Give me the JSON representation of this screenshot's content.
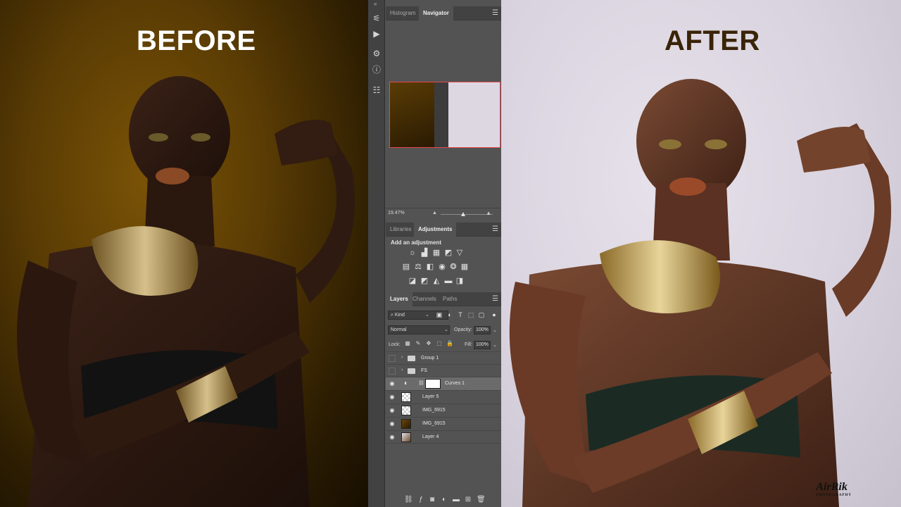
{
  "before": {
    "caption": "BEFORE"
  },
  "after": {
    "caption": "AFTER",
    "watermark": "AirRik",
    "watermark_sub": "PHOTOGRAPHY"
  },
  "navigator": {
    "tabs": [
      {
        "label": "Histogram",
        "active": false
      },
      {
        "label": "Navigator",
        "active": true
      }
    ],
    "zoom": "19.47%"
  },
  "adjustments": {
    "tabs": [
      {
        "label": "Libraries",
        "active": false
      },
      {
        "label": "Adjustments",
        "active": true
      }
    ],
    "title": "Add an adjustment"
  },
  "layers_panel": {
    "tabs": [
      {
        "label": "Layers",
        "active": true
      },
      {
        "label": "Channels",
        "active": false
      },
      {
        "label": "Paths",
        "active": false
      }
    ],
    "kind_filter": "Kind",
    "blend_mode": "Normal",
    "opacity_label": "Opacity:",
    "opacity": "100%",
    "lock_label": "Lock:",
    "fill_label": "Fill:",
    "fill": "100%",
    "layers": [
      {
        "name": "Group 1",
        "type": "group",
        "visible": false,
        "selected": false
      },
      {
        "name": "FS",
        "type": "group",
        "visible": false,
        "selected": false
      },
      {
        "name": "Curves 1",
        "type": "adjustment",
        "visible": true,
        "selected": true
      },
      {
        "name": "Layer 5",
        "type": "pixel",
        "visible": true,
        "selected": false
      },
      {
        "name": "IMG_6915",
        "type": "pixel",
        "visible": true,
        "selected": false
      },
      {
        "name": "IMG_6915",
        "type": "pixel",
        "visible": true,
        "selected": false
      },
      {
        "name": "Layer 4",
        "type": "pixel",
        "visible": true,
        "selected": false
      }
    ]
  }
}
